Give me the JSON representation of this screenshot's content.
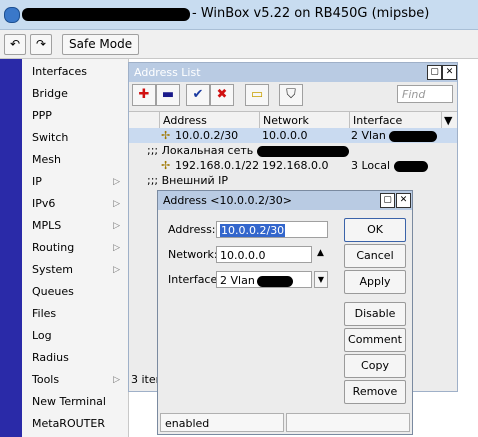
{
  "window": {
    "title": "- WinBox v5.22 on RB450G (mipsbe)"
  },
  "toolbar": {
    "undo_icon": "undo-icon",
    "redo_icon": "redo-icon",
    "safe_mode_label": "Safe Mode"
  },
  "menu": {
    "items": [
      {
        "label": "Interfaces",
        "submenu": false
      },
      {
        "label": "Bridge",
        "submenu": false
      },
      {
        "label": "PPP",
        "submenu": false
      },
      {
        "label": "Switch",
        "submenu": false
      },
      {
        "label": "Mesh",
        "submenu": false
      },
      {
        "label": "IP",
        "submenu": true
      },
      {
        "label": "IPv6",
        "submenu": true
      },
      {
        "label": "MPLS",
        "submenu": true
      },
      {
        "label": "Routing",
        "submenu": true
      },
      {
        "label": "System",
        "submenu": true
      },
      {
        "label": "Queues",
        "submenu": false
      },
      {
        "label": "Files",
        "submenu": false
      },
      {
        "label": "Log",
        "submenu": false
      },
      {
        "label": "Radius",
        "submenu": false
      },
      {
        "label": "Tools",
        "submenu": true
      },
      {
        "label": "New Terminal",
        "submenu": false
      },
      {
        "label": "MetaROUTER",
        "submenu": false
      }
    ],
    "arrow_glyph": "▷"
  },
  "address_list": {
    "title": "Address List",
    "find_placeholder": "Find",
    "columns": [
      "Address",
      "Network",
      "Interface"
    ],
    "rows": [
      {
        "type": "entry",
        "address": "10.0.0.2/30",
        "network": "10.0.0.0",
        "interface": "2 Vlan",
        "selected": true
      },
      {
        "type": "comment",
        "text": ";;; Локальная сеть"
      },
      {
        "type": "entry",
        "address": "192.168.0.1/22",
        "network": "192.168.0.0",
        "interface": "3 Local",
        "selected": false
      },
      {
        "type": "comment",
        "text": ";;; Внешний IP"
      }
    ],
    "status": "3 item"
  },
  "dialog": {
    "title": "Address <10.0.0.2/30>",
    "address_label": "Address:",
    "address_value": "10.0.0.2/30",
    "network_label": "Network:",
    "network_value": "10.0.0.0",
    "interface_label": "Interface:",
    "interface_value": "2 Vlan",
    "buttons": {
      "ok": "OK",
      "cancel": "Cancel",
      "apply": "Apply",
      "disable": "Disable",
      "comment": "Comment",
      "copy": "Copy",
      "remove": "Remove"
    },
    "status": "enabled"
  },
  "colors": {
    "accent": "#2a2aa8",
    "selection": "#3366cc",
    "titlebar": "#c8dcf0"
  }
}
